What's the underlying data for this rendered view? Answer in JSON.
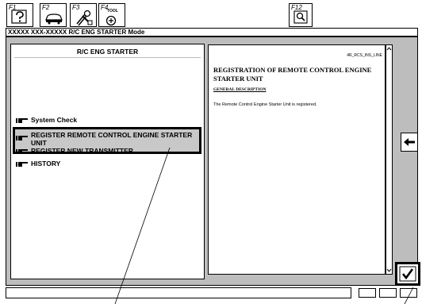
{
  "toolbar": {
    "f1": "F1",
    "f2": "F2",
    "f3": "F3",
    "f4": "F4",
    "f4_sub": "TOOL",
    "f12": "F12"
  },
  "window_title": "XXXXX XXX-XXXXX R/C ENG STARTER Mode",
  "left_panel": {
    "header": "R/C ENG STARTER",
    "items": [
      {
        "label": "System Check"
      },
      {
        "label": "REGISTER REMOTE CONTROL ENGINE STARTER UNIT"
      },
      {
        "label": "REGISTER NEW TRANSMITTER"
      },
      {
        "label": "HISTORY"
      }
    ]
  },
  "right_panel": {
    "code": "4R_RCS_INS_LINE",
    "title": "REGISTRATION OF REMOTE CONTROL ENGINE STARTER UNIT",
    "section": "GENERAL DESCRIPTION",
    "description": "The Remote Control Engine Starter Unit is registered."
  },
  "icons": {
    "f1": "help-icon",
    "f2": "car-icon",
    "f3": "tools-icon",
    "f4": "tool-icon",
    "f12": "search-icon",
    "back": "left-arrow-icon",
    "confirm": "checkmark-icon",
    "menu": "pointing-hand-icon"
  }
}
